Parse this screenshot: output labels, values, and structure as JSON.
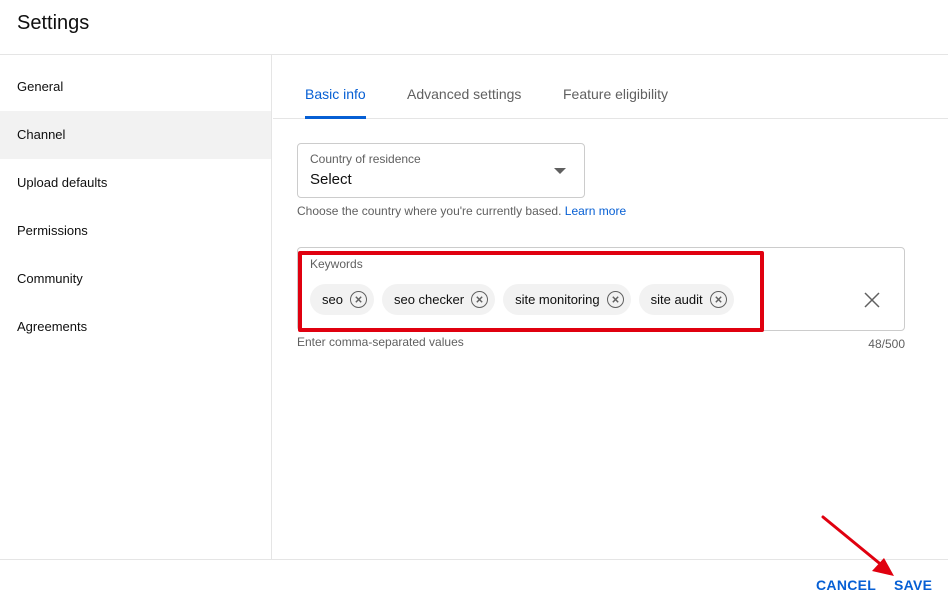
{
  "header": {
    "title": "Settings"
  },
  "sidebar": {
    "items": [
      {
        "label": "General"
      },
      {
        "label": "Channel"
      },
      {
        "label": "Upload defaults"
      },
      {
        "label": "Permissions"
      },
      {
        "label": "Community"
      },
      {
        "label": "Agreements"
      }
    ]
  },
  "tabs": [
    {
      "label": "Basic info"
    },
    {
      "label": "Advanced settings"
    },
    {
      "label": "Feature eligibility"
    }
  ],
  "country": {
    "label": "Country of residence",
    "value": "Select",
    "help_text": "Choose the country where you're currently based.",
    "learn_more": "Learn more"
  },
  "keywords": {
    "label": "Keywords",
    "chips": [
      "seo",
      "seo checker",
      "site monitoring",
      "site audit"
    ],
    "help_text": "Enter comma-separated values",
    "count": "48/500"
  },
  "footer": {
    "cancel_label": "CANCEL",
    "save_label": "SAVE"
  },
  "colors": {
    "accent": "#065fd4",
    "annotation": "#e0000f"
  }
}
